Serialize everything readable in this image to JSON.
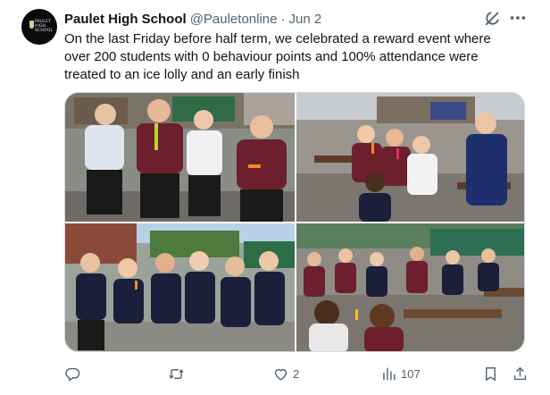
{
  "tweet": {
    "avatar_text": "PAULET HIGH SCHOOL",
    "author_name": "Paulet High School",
    "handle": "@Pauletonline",
    "separator": "·",
    "date": "Jun 2",
    "text": "On the last Friday before half term, we celebrated a reward event where over 200 students with 0 behaviour points and 100% attendance were treated to an ice lolly and an early finish"
  },
  "actions": {
    "reply_count": "",
    "retweet_count": "",
    "like_count": "2",
    "view_count": "107"
  },
  "icons": {
    "reply": "reply-icon",
    "retweet": "retweet-icon",
    "like": "heart-icon",
    "views": "analytics-icon",
    "bookmark": "bookmark-icon",
    "share": "share-icon",
    "grok": "grok-icon",
    "more": "more-icon"
  },
  "colors": {
    "text_primary": "#0f1419",
    "text_secondary": "#536471",
    "border": "#cfd9de",
    "uniform_maroon": "#6e1f2e",
    "uniform_navy": "#1b1f3a"
  }
}
